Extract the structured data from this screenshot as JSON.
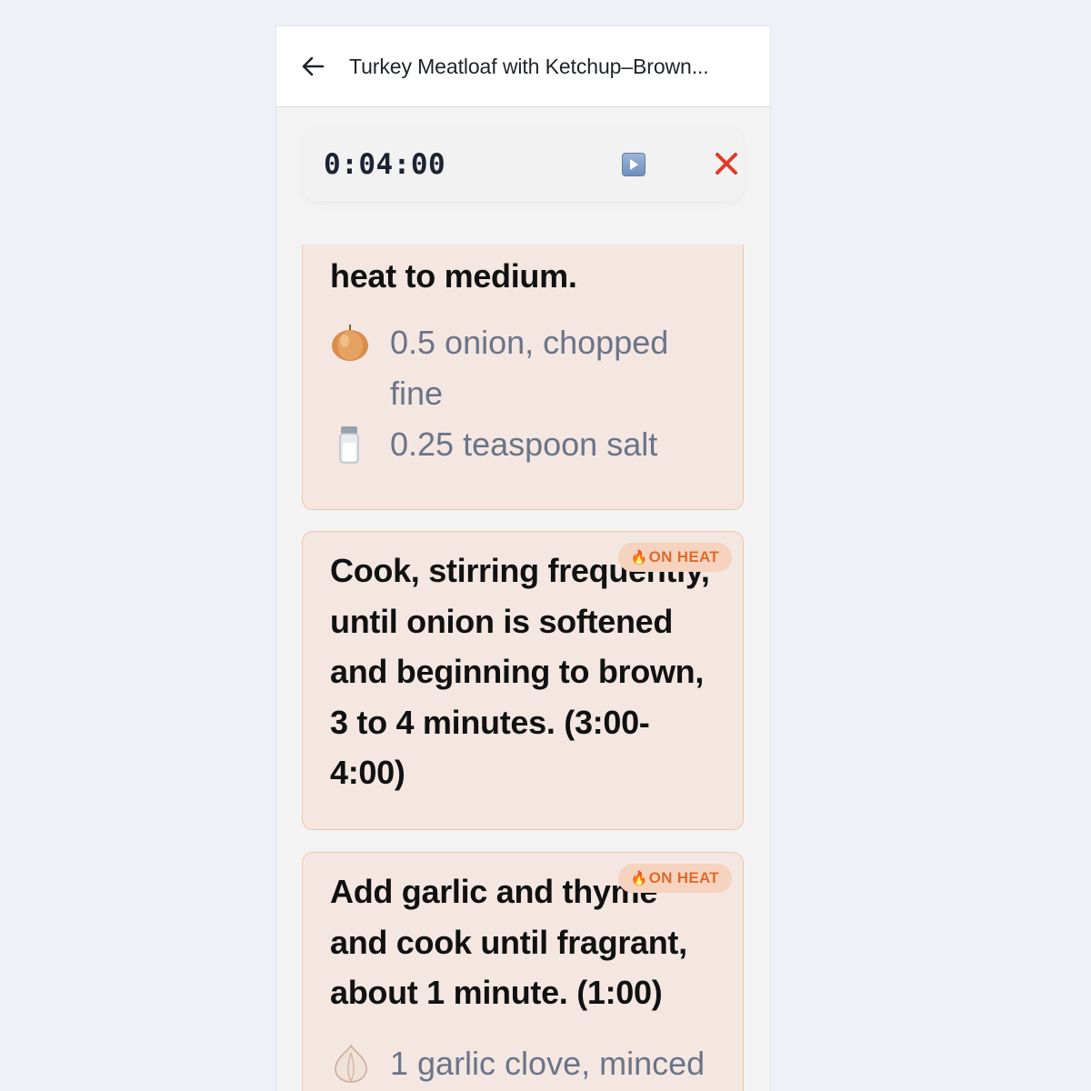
{
  "header": {
    "title": "Turkey Meatloaf with Ketchup–Brown..."
  },
  "timer": {
    "display": "0:04:00"
  },
  "steps": [
    {
      "text_tail": "teaspoon salt, increase heat to medium.",
      "ingredients": [
        {
          "icon": "onion-icon",
          "text": "0.5 onion, chopped fine"
        },
        {
          "icon": "salt-shaker-icon",
          "text": "0.25 teaspoon salt"
        }
      ]
    },
    {
      "badge": "ON HEAT",
      "text": "Cook, stirring frequently, until onion is softened and beginning to brown, 3 to 4 minutes. (3:00-4:00)"
    },
    {
      "badge": "ON HEAT",
      "text": "Add garlic and thyme and cook until fragrant, about 1 minute. (1:00)",
      "ingredients": [
        {
          "icon": "garlic-icon",
          "text": "1 garlic clove, minced"
        }
      ]
    }
  ],
  "colors": {
    "card_bg": "#f4e7e2",
    "card_border": "#f0c6ad",
    "badge_bg": "#f6d3bf",
    "badge_text": "#e06a2c",
    "close": "#e03a2a"
  }
}
